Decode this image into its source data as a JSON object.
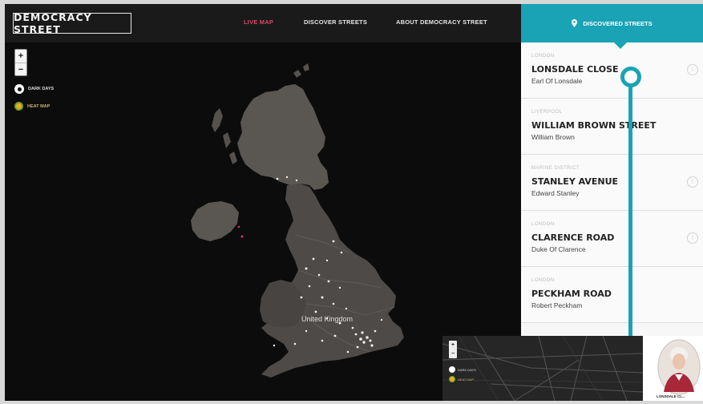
{
  "header": {
    "logo": "DEMOCRACY STREET",
    "nav": [
      "LIVE MAP",
      "DISCOVER STREETS",
      "ABOUT DEMOCRACY STREET"
    ],
    "discovered_tab": "DISCOVERED STREETS",
    "accent_color": "#1aa3b5",
    "active_nav_color": "#d9476a"
  },
  "map": {
    "zoom_in": "+",
    "zoom_out": "−",
    "legend": [
      {
        "label": "DARK DAYS",
        "icon": "dark-days-icon"
      },
      {
        "label": "HEAT MAP",
        "icon": "heat-map-icon"
      }
    ],
    "place_label": "United Kingdom"
  },
  "sidebar": {
    "streets": [
      {
        "location": "LONDON",
        "street": "LONSDALE CLOSE",
        "person": "Earl Of Lonsdale"
      },
      {
        "location": "LIVERPOOL",
        "street": "WILLIAM BROWN STREET",
        "person": "William Brown"
      },
      {
        "location": "MARINE DISTRICT",
        "street": "STANLEY AVENUE",
        "person": "Edward Stanley"
      },
      {
        "location": "LONDON",
        "street": "CLARENCE ROAD",
        "person": "Duke Of Clarence"
      },
      {
        "location": "LONDON",
        "street": "PECKHAM ROAD",
        "person": "Robert Peckham"
      }
    ]
  },
  "inset": {
    "zoom_in": "+",
    "zoom_out": "−",
    "legend": [
      "DARK DAYS",
      "HEAT MAP"
    ],
    "portrait_label": "LONSDALE CL..."
  }
}
